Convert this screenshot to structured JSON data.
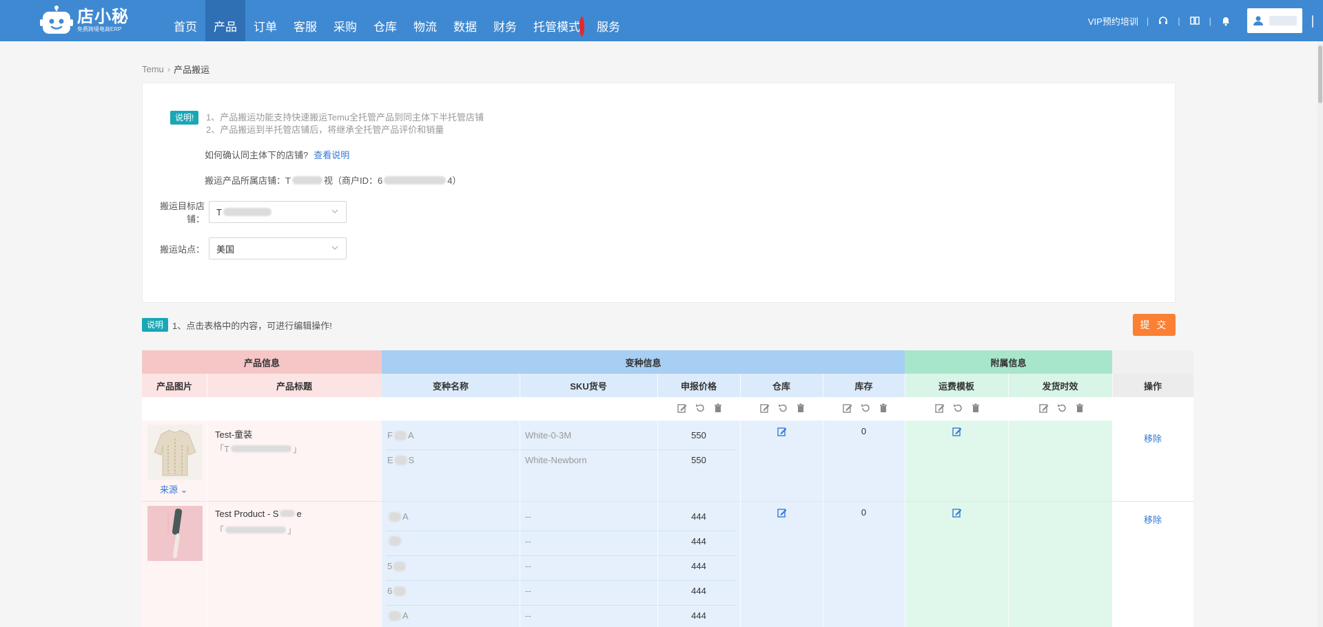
{
  "nav": {
    "logo_name": "店小秘",
    "logo_sub": "免费跨境电商ERP",
    "items": [
      "首页",
      "产品",
      "订单",
      "客服",
      "采购",
      "仓库",
      "物流",
      "数据",
      "财务",
      "托管模式",
      "服务"
    ],
    "active_index": 1,
    "dot_index": 9,
    "vip_label": "VIP预约培训"
  },
  "breadcrumb": {
    "root": "Temu",
    "current": "产品搬运"
  },
  "info": {
    "badge": "说明!",
    "line1": "1、产品搬运功能支持快速搬运Temu全托管产品到同主体下半托管店铺",
    "line2": "2、产品搬运到半托管店铺后，将继承全托管产品评价和销量",
    "question": "如何确认同主体下的店铺?",
    "question_link": "查看说明",
    "source_label": "搬运产品所属店铺：T",
    "source_mid": "视（商户ID：6",
    "source_end": "4）",
    "target_label": "搬运目标店铺：",
    "target_value": "T",
    "site_label": "搬运站点：",
    "site_value": "美国"
  },
  "table_note": {
    "badge": "说明",
    "text": "1、点击表格中的内容，可进行编辑操作!"
  },
  "submit_label": "提 交",
  "table": {
    "groups": {
      "product": "产品信息",
      "variant": "变种信息",
      "attach": "附属信息"
    },
    "headers": {
      "image": "产品图片",
      "title": "产品标题",
      "variant_name": "变种名称",
      "sku": "SKU货号",
      "price": "申报价格",
      "warehouse": "仓库",
      "stock": "库存",
      "shipping": "运费模板",
      "lead": "发货时效",
      "ops": "操作"
    },
    "rows": [
      {
        "title": "Test-童装",
        "title_sub_open": "「T",
        "title_sub_close": "」",
        "source_label": "来源",
        "stock": "0",
        "remove_label": "移除",
        "variants": [
          {
            "name": "F",
            "name_tail": "A",
            "sku": "White-0-3M",
            "price": "550"
          },
          {
            "name": "E",
            "name_tail": "S",
            "sku": "White-Newborn",
            "price": "550"
          }
        ]
      },
      {
        "title": "Test Product - S",
        "title_tail": "e",
        "title_sub_open": "「",
        "title_sub_close": "」",
        "stock": "0",
        "remove_label": "移除",
        "variants": [
          {
            "name": "",
            "name_tail": "A",
            "sku": "--",
            "price": "444"
          },
          {
            "name": "",
            "name_tail": "",
            "sku": "--",
            "price": "444"
          },
          {
            "name": "5",
            "name_tail": "",
            "sku": "--",
            "price": "444"
          },
          {
            "name": "6",
            "name_tail": "",
            "sku": "--",
            "price": "444"
          },
          {
            "name": "",
            "name_tail": "A",
            "sku": "--",
            "price": "444"
          }
        ]
      }
    ]
  }
}
